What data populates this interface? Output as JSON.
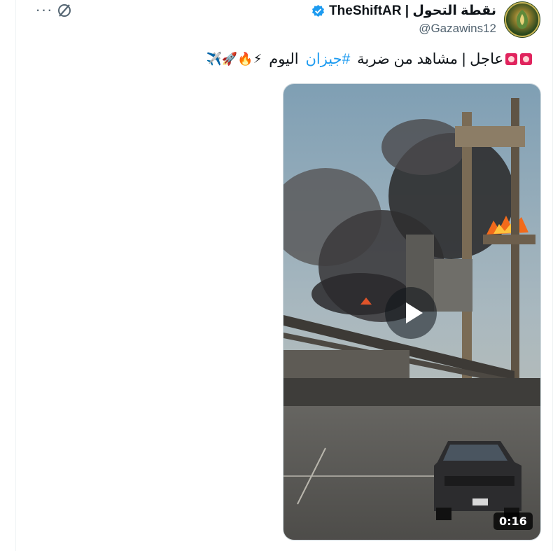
{
  "tweet": {
    "display_name": "TheShiftAR | نقطة التحول",
    "handle": "@Gazawins12",
    "verified": true,
    "text_prefix": "عاجل | مشاهد من ضربة",
    "hashtag": "#جيزان",
    "text_suffix": "اليوم",
    "emojis_trailing": "⚡🔥🚀✈️",
    "more_icon": "more-horizontal-icon",
    "grok_icon": "grok-icon"
  },
  "media": {
    "type": "video",
    "duration": "0:16",
    "play_icon": "play-icon"
  },
  "colors": {
    "accent": "#1d9bf0",
    "text": "#0f1419",
    "secondary": "#536471"
  }
}
